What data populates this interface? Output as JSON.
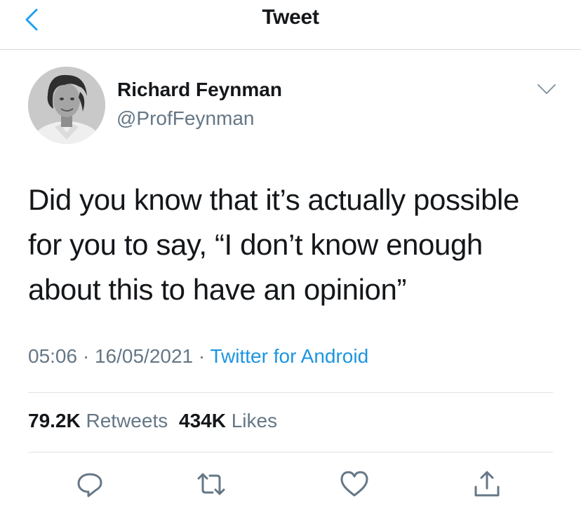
{
  "header": {
    "title": "Tweet",
    "back_icon": "chevron-left-icon"
  },
  "author": {
    "name": "Richard Feynman",
    "handle": "@ProfFeynman",
    "menu_icon": "chevron-down-icon"
  },
  "tweet": {
    "lines": [
      "Did you know that it’s actually possible",
      "for you to say, “I don’t know enough",
      "about this to have an opinion”"
    ]
  },
  "meta": {
    "time": "05:06",
    "separator": " · ",
    "date": "16/05/2021",
    "source": "Twitter for Android"
  },
  "stats": {
    "retweets_count": "79.2K",
    "retweets_label": "Retweets",
    "likes_count": "434K",
    "likes_label": "Likes"
  },
  "actions": [
    {
      "icon": "reply-icon"
    },
    {
      "icon": "retweet-icon"
    },
    {
      "icon": "like-heart-icon"
    },
    {
      "icon": "share-icon"
    }
  ],
  "colors": {
    "accent": "#1b95e0",
    "secondary_text": "#657786",
    "primary_text": "#14171a",
    "divider": "#dfe3e6"
  }
}
